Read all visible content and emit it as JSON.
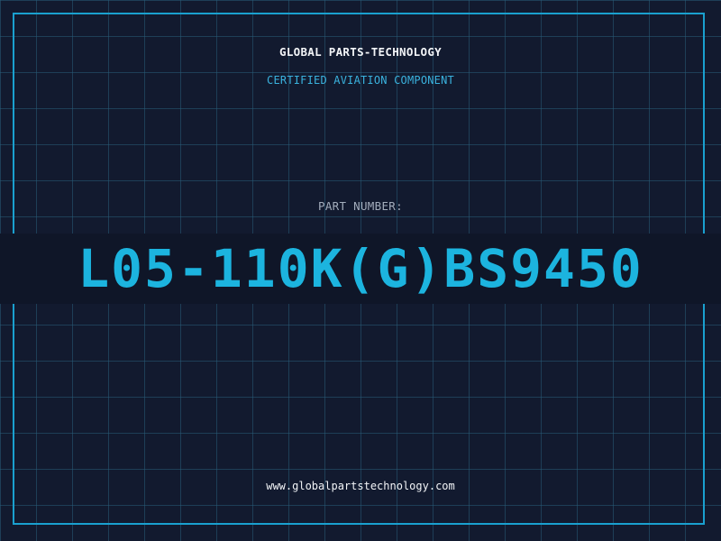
{
  "header": {
    "title": "GLOBAL PARTS-TECHNOLOGY",
    "subtitle": "CERTIFIED AVIATION COMPONENT"
  },
  "part": {
    "label": "PART NUMBER:",
    "number": "L05-110K(G)BS9450"
  },
  "footer": {
    "url": "www.globalpartstechnology.com"
  },
  "colors": {
    "background": "#121a2f",
    "grid": "#285c78",
    "frame": "#1aa0cf",
    "accent": "#1cb4df",
    "title_text": "#f2f4f7",
    "label_text": "#a3adbc"
  }
}
